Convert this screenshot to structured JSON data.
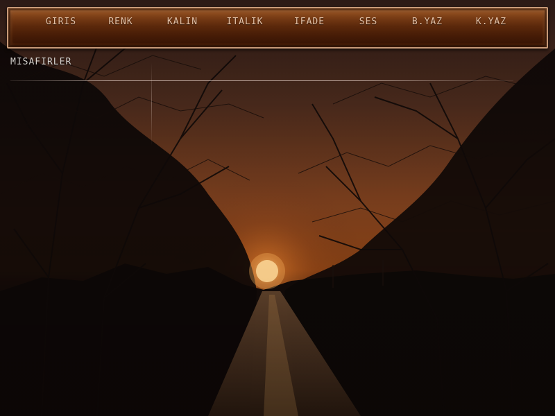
{
  "toolbar": {
    "buttons": [
      "GIRIS",
      "RENK",
      "KALIN",
      "ITALIK",
      "IFADE",
      "SES",
      "B.YAZ",
      "K.YAZ"
    ]
  },
  "guests": {
    "label": "MISAFIRLER"
  },
  "colors": {
    "toolbar_brown": "#6a3412",
    "toolbar_border": "#c89a78",
    "button_text": "#e4c2a8",
    "sun": "#ffd9a0"
  },
  "background": {
    "scene": "sunset-road-with-bare-trees"
  }
}
